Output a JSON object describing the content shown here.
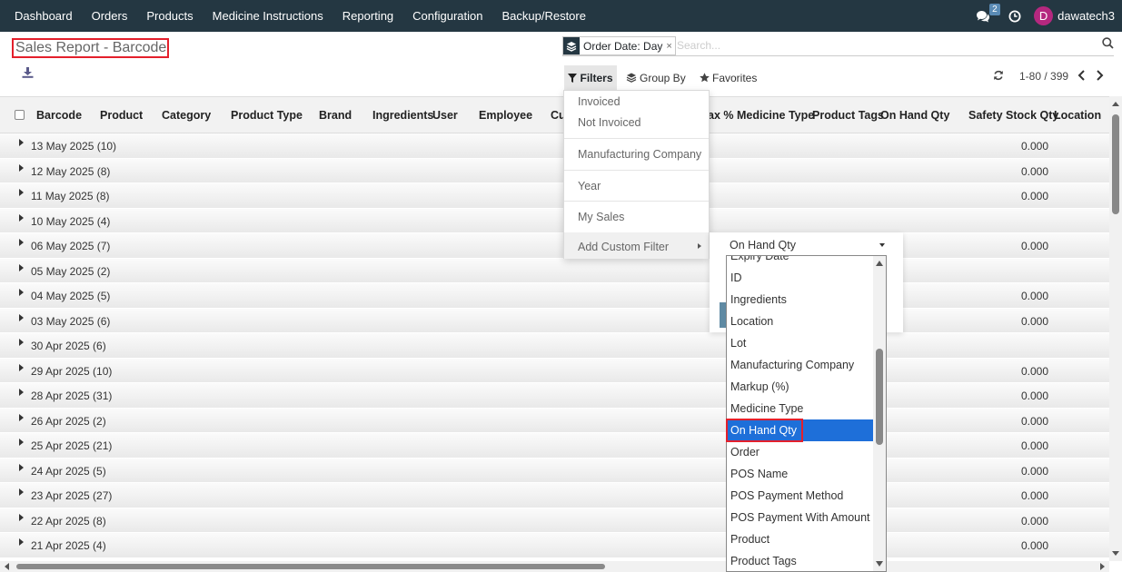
{
  "navbar": {
    "menu": [
      "Dashboard",
      "Orders",
      "Products",
      "Medicine Instructions",
      "Reporting",
      "Configuration",
      "Backup/Restore"
    ],
    "messages_icon": "chat-icon",
    "message_count": "2",
    "activity_icon": "clock-icon",
    "user_initial": "D",
    "username": "dawatech3"
  },
  "page": {
    "title": "Sales Report - Barcode"
  },
  "search": {
    "facet_icon": "layers-icon",
    "facet_value": "Order Date: Day",
    "facet_remove": "×",
    "placeholder": "Search..."
  },
  "toolbar": {
    "filters_label": "Filters",
    "group_by_label": "Group By",
    "favorites_label": "Favorites"
  },
  "pager": {
    "value": "1-80 / 399"
  },
  "columns": [
    "Barcode",
    "Product",
    "Category",
    "Product Type",
    "Brand",
    "Ingredients",
    "User",
    "Employee",
    "Cu",
    "ax %",
    "Medicine Type",
    "Product Tags",
    "On Hand Qty",
    "Safety Stock Qty",
    "Location"
  ],
  "groups": [
    {
      "label": "13 May 2025 (10)",
      "safety_stock": "0.000"
    },
    {
      "label": "12 May 2025 (8)",
      "safety_stock": "0.000"
    },
    {
      "label": "11 May 2025 (8)",
      "safety_stock": "0.000"
    },
    {
      "label": "10 May 2025 (4)",
      "safety_stock": ""
    },
    {
      "label": "06 May 2025 (7)",
      "safety_stock": "0.000"
    },
    {
      "label": "05 May 2025 (2)",
      "safety_stock": ""
    },
    {
      "label": "04 May 2025 (5)",
      "safety_stock": "0.000"
    },
    {
      "label": "03 May 2025 (6)",
      "safety_stock": "0.000"
    },
    {
      "label": "30 Apr 2025 (6)",
      "safety_stock": ""
    },
    {
      "label": "29 Apr 2025 (10)",
      "safety_stock": "0.000"
    },
    {
      "label": "28 Apr 2025 (31)",
      "safety_stock": "0.000"
    },
    {
      "label": "26 Apr 2025 (2)",
      "safety_stock": "0.000"
    },
    {
      "label": "25 Apr 2025 (21)",
      "safety_stock": "0.000"
    },
    {
      "label": "24 Apr 2025 (5)",
      "safety_stock": "0.000"
    },
    {
      "label": "23 Apr 2025 (27)",
      "safety_stock": "0.000"
    },
    {
      "label": "22 Apr 2025 (8)",
      "safety_stock": "0.000"
    },
    {
      "label": "21 Apr 2025 (4)",
      "safety_stock": "0.000"
    }
  ],
  "filters_menu": {
    "items": [
      "Invoiced",
      "Not Invoiced",
      "Manufacturing Company",
      "Year",
      "My Sales"
    ],
    "custom_filter_label": "Add Custom Filter"
  },
  "custom_filter": {
    "selected_field": "On Hand Qty",
    "field_options": [
      "Expiry Date",
      "ID",
      "Ingredients",
      "Location",
      "Lot",
      "Manufacturing Company",
      "Markup (%)",
      "Medicine Type",
      "On Hand Qty",
      "Order",
      "POS Name",
      "POS Payment Method",
      "POS Payment With Amount",
      "Product",
      "Product Tags"
    ],
    "highlighted_option": "On Hand Qty"
  },
  "colors": {
    "navbar": "#243742",
    "highlight_outline": "#e4202c",
    "selected_option": "#1e6fd9",
    "avatar": "#b5287f"
  }
}
